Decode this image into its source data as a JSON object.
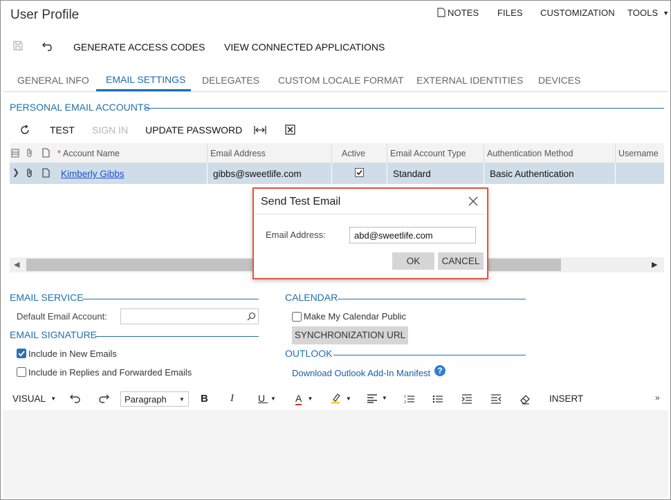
{
  "header": {
    "title": "User Profile",
    "nav": [
      "NOTES",
      "FILES",
      "CUSTOMIZATION",
      "TOOLS"
    ]
  },
  "toolbar": {
    "generate_label": "GENERATE ACCESS CODES",
    "view_connected_label": "VIEW CONNECTED APPLICATIONS"
  },
  "tabs": [
    {
      "label": "GENERAL INFO"
    },
    {
      "label": "EMAIL SETTINGS"
    },
    {
      "label": "DELEGATES"
    },
    {
      "label": "CUSTOM LOCALE FORMAT"
    },
    {
      "label": "EXTERNAL IDENTITIES"
    },
    {
      "label": "DEVICES"
    }
  ],
  "personal_accounts": {
    "section_title": "PERSONAL EMAIL ACCOUNTS",
    "toolbar": {
      "test": "TEST",
      "sign_in": "SIGN IN",
      "update_password": "UPDATE PASSWORD"
    },
    "columns": {
      "required_mark": "*",
      "account_name": "Account Name",
      "email_address": "Email Address",
      "active": "Active",
      "account_type": "Email Account Type",
      "auth_method": "Authentication Method",
      "username": "Username"
    },
    "rows": [
      {
        "account_name": "Kimberly Gibbs",
        "email_address": "gibbs@sweetlife.com",
        "active": true,
        "account_type": "Standard",
        "auth_method": "Basic Authentication",
        "username": ""
      }
    ]
  },
  "email_service": {
    "section_title": "EMAIL SERVICE",
    "default_account_label": "Default Email Account:",
    "default_account_value": ""
  },
  "email_signature": {
    "section_title": "EMAIL SIGNATURE",
    "include_new_label": "Include in New Emails",
    "include_new_checked": true,
    "include_replies_label": "Include in Replies and Forwarded Emails",
    "include_replies_checked": false
  },
  "calendar": {
    "section_title": "CALENDAR",
    "public_label": "Make My Calendar Public",
    "public_checked": false,
    "sync_button": "SYNCHRONIZATION URL"
  },
  "outlook": {
    "section_title": "OUTLOOK",
    "manifest_link": "Download Outlook Add-In Manifest"
  },
  "editor": {
    "mode": "VISUAL",
    "paragraph": "Paragraph",
    "bold": "B",
    "italic": "I",
    "underline": "U",
    "font_color": "A",
    "insert": "INSERT"
  },
  "modal": {
    "title": "Send Test Email",
    "email_label": "Email Address:",
    "email_value": "abd@sweetlife.com",
    "ok_label": "OK",
    "cancel_label": "CANCEL"
  },
  "colors": {
    "accent": "#1a6bb3",
    "selected_row": "#cfdde9",
    "modal_border": "#e4553c"
  }
}
